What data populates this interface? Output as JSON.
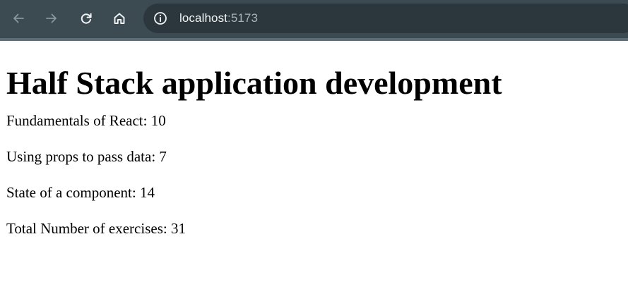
{
  "browser": {
    "url_host": "localhost",
    "url_port": ":5173",
    "icons": {
      "back": "arrow-left-icon",
      "forward": "arrow-right-icon",
      "reload": "reload-icon",
      "home": "home-icon",
      "site_info": "info-circle-icon"
    },
    "colors": {
      "toolbar": "#3c4a52",
      "omnibox": "#2c373d",
      "icon_active": "#f1f3f4",
      "icon_disabled": "#8a979e"
    }
  },
  "page": {
    "header": "Half Stack application development",
    "parts": [
      {
        "name": "Fundamentals of React",
        "exercises": "10"
      },
      {
        "name": "Using props to pass data",
        "exercises": "7"
      },
      {
        "name": "State of a component",
        "exercises": "14"
      }
    ],
    "total_label": "Total Number of exercises",
    "total": "31"
  }
}
